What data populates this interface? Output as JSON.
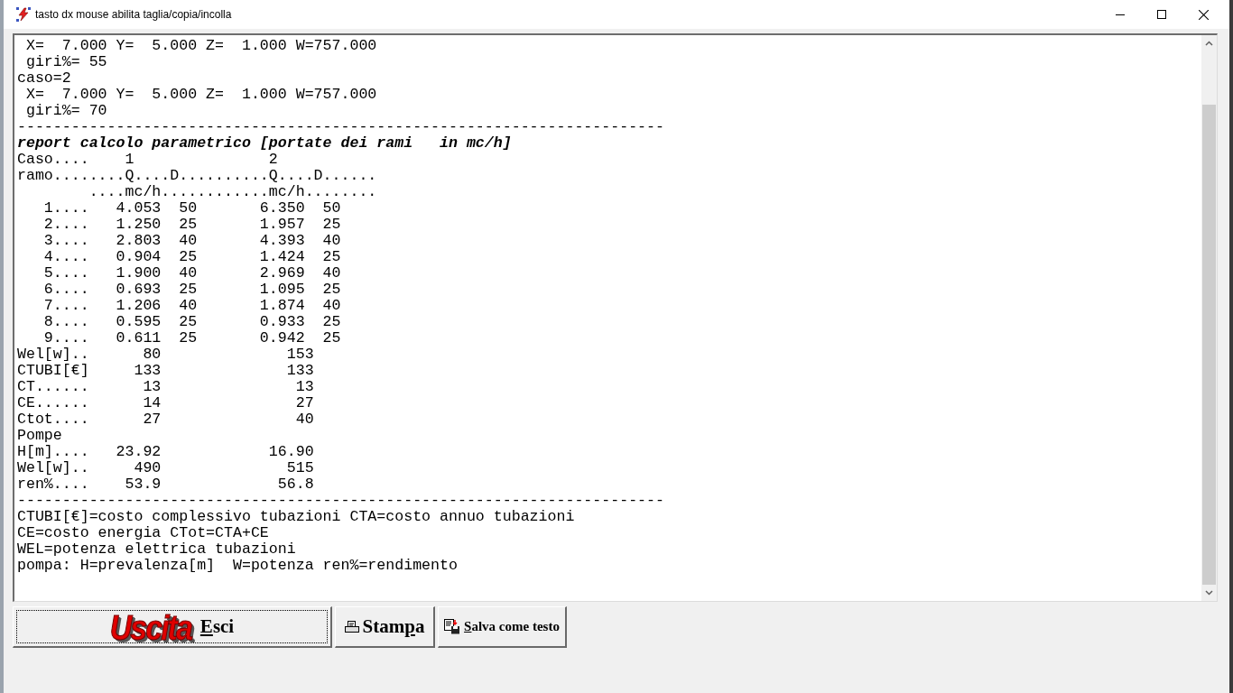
{
  "window": {
    "title": "tasto dx mouse abilita taglia/copia/incolla"
  },
  "report": {
    "lines": [
      {
        "kind": "plain",
        "text": " X=  7.000 Y=  5.000 Z=  1.000 W=757.000"
      },
      {
        "kind": "plain",
        "text": " giri%= 55"
      },
      {
        "kind": "plain",
        "text": "caso=2"
      },
      {
        "kind": "plain",
        "text": " X=  7.000 Y=  5.000 Z=  1.000 W=757.000"
      },
      {
        "kind": "plain",
        "text": " giri%= 70"
      },
      {
        "kind": "plain",
        "text": "------------------------------------------------------------------------"
      },
      {
        "kind": "heading",
        "text": "report calcolo parametrico [portate dei rami   in mc/h]"
      },
      {
        "kind": "plain",
        "text": "Caso....    1               2"
      },
      {
        "kind": "plain",
        "text": "ramo........Q....D..........Q....D......"
      },
      {
        "kind": "plain",
        "text": "        ....mc/h............mc/h........"
      },
      {
        "kind": "plain",
        "text": "   1....   4.053  50       6.350  50"
      },
      {
        "kind": "plain",
        "text": "   2....   1.250  25       1.957  25"
      },
      {
        "kind": "plain",
        "text": "   3....   2.803  40       4.393  40"
      },
      {
        "kind": "plain",
        "text": "   4....   0.904  25       1.424  25"
      },
      {
        "kind": "plain",
        "text": "   5....   1.900  40       2.969  40"
      },
      {
        "kind": "plain",
        "text": "   6....   0.693  25       1.095  25"
      },
      {
        "kind": "plain",
        "text": "   7....   1.206  40       1.874  40"
      },
      {
        "kind": "plain",
        "text": "   8....   0.595  25       0.933  25"
      },
      {
        "kind": "plain",
        "text": "   9....   0.611  25       0.942  25"
      },
      {
        "kind": "plain",
        "text": "Wel[w]..      80              153"
      },
      {
        "kind": "plain",
        "text": "CTUBI[€]     133              133"
      },
      {
        "kind": "plain",
        "text": "CT......      13               13"
      },
      {
        "kind": "plain",
        "text": "CE......      14               27"
      },
      {
        "kind": "plain",
        "text": "Ctot....      27               40"
      },
      {
        "kind": "plain",
        "text": "Pompe"
      },
      {
        "kind": "plain",
        "text": "H[m]....   23.92            16.90"
      },
      {
        "kind": "plain",
        "text": "Wel[w]..     490              515"
      },
      {
        "kind": "plain",
        "text": "ren%....    53.9             56.8"
      },
      {
        "kind": "plain",
        "text": "------------------------------------------------------------------------"
      },
      {
        "kind": "plain",
        "text": "CTUBI[€]=costo complessivo tubazioni CTA=costo annuo tubazioni"
      },
      {
        "kind": "plain",
        "text": "CE=costo energia CTot=CTA+CE"
      },
      {
        "kind": "plain",
        "text": "WEL=potenza elettrica tubazioni"
      },
      {
        "kind": "plain",
        "text": "pompa: H=prevalenza[m]  W=potenza ren%=rendimento"
      }
    ]
  },
  "buttons": [
    {
      "kind": "exit",
      "logo_text": "Uscita",
      "label": {
        "mnemonic": "E",
        "suffix": "sci"
      },
      "focused": true
    },
    {
      "kind": "print",
      "label": {
        "prefix": "Stam",
        "mnemonic": "p",
        "suffix": "a"
      },
      "focused": false
    },
    {
      "kind": "save",
      "label": {
        "mnemonic": "S",
        "suffix": "alva come testo"
      },
      "focused": false
    }
  ]
}
